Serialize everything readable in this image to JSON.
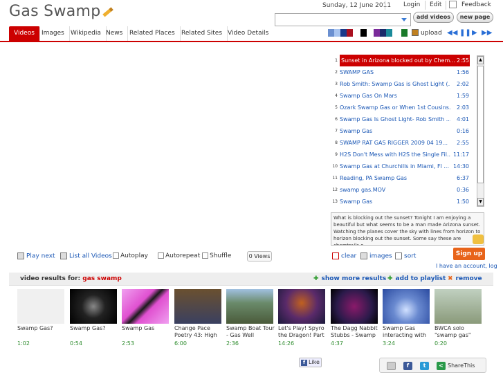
{
  "header": {
    "logo": "Gas Swamp",
    "date": "Sunday, 12 June 2011",
    "login": "Login",
    "edit": "Edit",
    "feedback": "Feedback",
    "search_value": "",
    "add_videos": "add videos",
    "new_page": "new page"
  },
  "tabs": [
    {
      "label": "Videos"
    },
    {
      "label": "Images"
    },
    {
      "label": "Wikipedia"
    },
    {
      "label": "News"
    },
    {
      "label": "Related Places"
    },
    {
      "label": "Related Sites"
    },
    {
      "label": "Video Details"
    }
  ],
  "toolbar": {
    "upload": "upload",
    "swatches": [
      "#6a8fd0",
      "#a8c4f0",
      "#1a3a8a",
      "#aa1020",
      "#ffffff",
      "#000000",
      "#ffffff",
      "#7a2a9a",
      "#1a2a6a",
      "#1a8a9a",
      "#ffffff",
      "#1a7a2a"
    ]
  },
  "playlist": [
    {
      "n": "1",
      "title": "Sunset in Arizona blocked out by Chem...",
      "dur": "2:55"
    },
    {
      "n": "2",
      "title": "SWAMP GAS",
      "dur": "1:56"
    },
    {
      "n": "3",
      "title": "Rob Smith: Swamp Gas is Ghost Light (…",
      "dur": "2:02"
    },
    {
      "n": "4",
      "title": "Swamp Gas On Mars",
      "dur": "1:59"
    },
    {
      "n": "5",
      "title": "Ozark Swamp Gas or When 1st Cousins...",
      "dur": "2:03"
    },
    {
      "n": "6",
      "title": "Swamp Gas Is Ghost Light- Rob Smith  ...",
      "dur": "4:01"
    },
    {
      "n": "7",
      "title": "Swamp Gas",
      "dur": "0:16"
    },
    {
      "n": "8",
      "title": "SWAMP RAT GAS RIGGER 2009 04 19...",
      "dur": "2:55"
    },
    {
      "n": "9",
      "title": "H2S Don't Mess with H2S the Single Fil...",
      "dur": "11:17"
    },
    {
      "n": "10",
      "title": "Swamp Gas at Churchills in Miami, Fl   ...",
      "dur": "14:30"
    },
    {
      "n": "11",
      "title": "Reading, PA Swamp Gas",
      "dur": "6:37"
    },
    {
      "n": "12",
      "title": "swamp gas.MOV",
      "dur": "0:36"
    },
    {
      "n": "13",
      "title": "Swamp Gas",
      "dur": "1:50"
    }
  ],
  "description": "What is blocking out the sunset? Tonight I am enjoying a beautiful but what seems to be a man made Arizona sunset. Watching the planes cover the sky with lines from horizon to horizon blocking out the sunset. Some say these are chemtrails o...",
  "controls": {
    "play_next": "Play next",
    "list_all": "List all Videos",
    "autoplay": "Autoplay",
    "autorepeat": "Autorepeat",
    "shuffle": "Shuffle",
    "views": "0 Views",
    "clear": "clear",
    "images": "images",
    "sort": "sort",
    "signup": "Sign up",
    "have_account": "I have an account, log"
  },
  "results": {
    "label": "video results for:",
    "keyword": "gas swamp",
    "show_more": "show more results",
    "add_playlist": "add to playlist",
    "remove": "remove"
  },
  "thumbs": [
    {
      "title": "Swamp Gas?",
      "dur": "1:02"
    },
    {
      "title": "Swamp Gas?",
      "dur": "0:54"
    },
    {
      "title": "Swamp Gas",
      "dur": "2:53"
    },
    {
      "title": "Change Pace Poetry 43: High on",
      "dur": "6:00"
    },
    {
      "title": "Swamp Boat Tour - Gas Well",
      "dur": "2:36"
    },
    {
      "title": "Let's Play! Spyro the Dragon! Part",
      "dur": "14:26"
    },
    {
      "title": "The Dagg Nabbit Stubbs - Swamp",
      "dur": "4:37"
    },
    {
      "title": "Swamp Gas interacting with",
      "dur": "3:24"
    },
    {
      "title": "BWCA solo \"swamp gas\"",
      "dur": "0:20"
    }
  ],
  "social": {
    "like": "Like",
    "sharethis": "ShareThis"
  }
}
